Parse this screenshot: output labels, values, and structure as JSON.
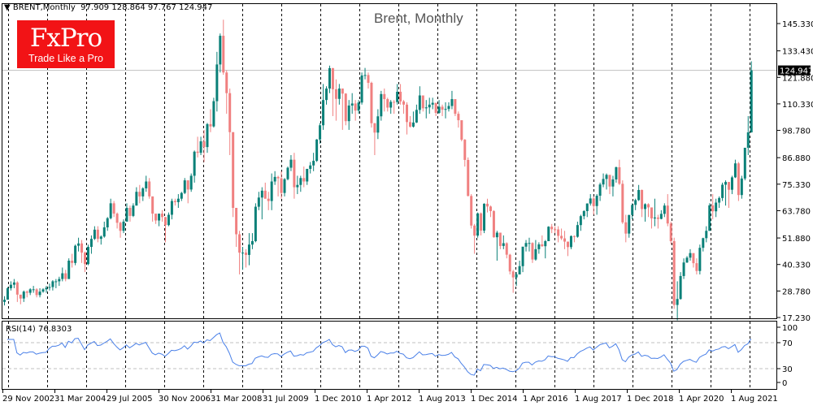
{
  "header": {
    "symbol": "BRENT,Monthly",
    "ohlc": "97.909 128.864 97.767 124.947"
  },
  "logo": {
    "brand": "FxPro",
    "tagline": "Trade Like a Pro"
  },
  "colors": {
    "bull": "#0a8078",
    "bear": "#f08080",
    "rsi": "#4a80e8",
    "grid": "#000000",
    "price_label_bg": "#000000"
  },
  "chart_data": {
    "type": "candlestick",
    "title": "Brent, Monthly",
    "timeframe": "monthly",
    "first_bar": "Nov 2002",
    "last_bar": "Mar 2022",
    "ylim": [
      17.23,
      145.33
    ],
    "y_ticks": [
      "145.330",
      "133.430",
      "121.880",
      "110.330",
      "98.780",
      "86.880",
      "75.330",
      "63.780",
      "51.880",
      "40.330",
      "28.780",
      "17.230"
    ],
    "x_ticks": [
      "29 Nov 2002",
      "31 Mar 2004",
      "29 Jul 2005",
      "30 Nov 2006",
      "31 Mar 2008",
      "31 Jul 2009",
      "1 Dec 2010",
      "1 Apr 2012",
      "1 Aug 2013",
      "1 Dec 2014",
      "1 Apr 2016",
      "1 Aug 2017",
      "1 Dec 2018",
      "1 Apr 2020",
      "1 Aug 2021"
    ],
    "current_price": "124.947",
    "first_open": 24.0,
    "close": [
      25.0,
      30.0,
      31.5,
      32.5,
      27.2,
      25.5,
      28.5,
      28.0,
      29.5,
      29.5,
      27.0,
      28.5,
      29.5,
      30.2,
      30.5,
      33.0,
      33.0,
      34.0,
      36.5,
      34.0,
      42.0,
      41.0,
      48.5,
      49.5,
      45.5,
      40.5,
      48.0,
      51.5,
      55.5,
      51.5,
      52.5,
      56.5,
      60.5,
      67.0,
      62.5,
      58.5,
      55.0,
      59.0,
      65.0,
      61.5,
      66.0,
      72.0,
      70.0,
      73.5,
      76.5,
      70.0,
      62.5,
      59.5,
      62.5,
      61.0,
      57.5,
      62.0,
      68.0,
      67.5,
      69.0,
      71.5,
      77.0,
      73.0,
      79.0,
      89.5,
      89.0,
      94.0,
      91.5,
      101.5,
      100.5,
      111.5,
      127.5,
      140.0,
      124.0,
      115.0,
      98.0,
      65.0,
      53.5,
      45.5,
      45.5,
      44.5,
      49.0,
      50.5,
      65.5,
      69.5,
      72.5,
      69.0,
      68.0,
      76.5,
      78.5,
      77.9,
      71.5,
      77.5,
      82.5,
      86.0,
      74.0,
      75.0,
      78.0,
      76.5,
      82.0,
      83.5,
      85.5,
      94.8,
      101.0,
      112.0,
      117.0,
      125.9,
      116.7,
      112.5,
      117.0,
      114.8,
      102.8,
      109.6,
      110.5,
      107.4,
      110.9,
      122.7,
      122.9,
      119.5,
      101.9,
      97.8,
      104.9,
      114.6,
      112.4,
      108.7,
      111.2,
      111.1,
      115.6,
      111.4,
      110.0,
      102.4,
      100.4,
      102.2,
      107.7,
      114.0,
      108.4,
      108.8,
      110.0,
      110.8,
      106.4,
      109.1,
      107.8,
      108.1,
      109.4,
      112.4,
      106.0,
      103.2,
      94.7,
      85.9,
      70.2,
      57.3,
      52.9,
      62.6,
      55.1,
      66.8,
      65.6,
      63.6,
      52.2,
      54.2,
      48.4,
      49.6,
      44.6,
      37.3,
      34.7,
      36.0,
      39.6,
      48.1,
      49.7,
      49.7,
      42.5,
      47.0,
      49.1,
      48.3,
      50.5,
      56.8,
      55.7,
      55.6,
      52.8,
      51.7,
      50.3,
      47.9,
      52.7,
      52.4,
      57.5,
      61.4,
      63.6,
      66.9,
      69.1,
      65.8,
      70.3,
      75.2,
      77.6,
      79.4,
      74.3,
      77.4,
      82.7,
      75.5,
      58.7,
      53.8,
      61.9,
      66.3,
      68.4,
      72.8,
      64.5,
      66.6,
      65.2,
      60.4,
      60.8,
      60.2,
      62.4,
      66.0,
      58.2,
      50.5,
      22.7,
      25.3,
      35.3,
      41.2,
      43.3,
      45.3,
      40.9,
      37.5,
      47.6,
      51.8,
      55.0,
      66.1,
      63.5,
      67.3,
      69.3,
      75.1,
      76.3,
      72.9,
      78.3,
      84.4,
      70.6,
      77.8,
      91.2,
      97.909,
      124.947
    ],
    "high": [
      26.5,
      30.5,
      33,
      34,
      33,
      27,
      29,
      29,
      30,
      31,
      30,
      30,
      30,
      31,
      32,
      33.5,
      34,
      35,
      39,
      38,
      43,
      45,
      49,
      52,
      51,
      46,
      49,
      53,
      57,
      57,
      53,
      59,
      61,
      69,
      68,
      63,
      59,
      60,
      67,
      66,
      67,
      74,
      75,
      74,
      79,
      78,
      70,
      62,
      62,
      64,
      61,
      63,
      69,
      69,
      71,
      72,
      78,
      77,
      80,
      90,
      96,
      96,
      99,
      102,
      108,
      113,
      133,
      141,
      147,
      125,
      117,
      98,
      65,
      55,
      48,
      47,
      54,
      54,
      67,
      72,
      74,
      76,
      72,
      80,
      81,
      79,
      81,
      78,
      83,
      88,
      89,
      79,
      79,
      83,
      82,
      85,
      89,
      95,
      102,
      119,
      118,
      127,
      126,
      121,
      119,
      117,
      115,
      112,
      115,
      112,
      112,
      124,
      126,
      124,
      120,
      102,
      108,
      116,
      117,
      113,
      112,
      112,
      119,
      119,
      112,
      111,
      105,
      107,
      110,
      118,
      113,
      112,
      113,
      113,
      110,
      112,
      110,
      111,
      111,
      116,
      112,
      107,
      103,
      95,
      87,
      71,
      58,
      63,
      63,
      67,
      69,
      66,
      64,
      55,
      54,
      53,
      50,
      45,
      38,
      37,
      42,
      48,
      51,
      52,
      50,
      51,
      50,
      53,
      51,
      57,
      58,
      57,
      57,
      56,
      55,
      50,
      53,
      53,
      59,
      62,
      64,
      67,
      71,
      70,
      71,
      76,
      80,
      80,
      79,
      79,
      83,
      86,
      77,
      62,
      62,
      67,
      69,
      75,
      73,
      67,
      67,
      65,
      69,
      62,
      64,
      67,
      71,
      59,
      52,
      33,
      37,
      43,
      44,
      47,
      45,
      43,
      49,
      52,
      57,
      67,
      71,
      69,
      70,
      76,
      77,
      73,
      79,
      86,
      85,
      79,
      91,
      105,
      128.864
    ],
    "low": [
      22.5,
      25,
      29,
      30,
      24,
      23,
      24,
      26,
      27,
      28,
      26,
      26,
      28,
      28,
      29,
      29,
      30,
      31,
      33,
      33,
      34,
      39,
      40,
      46,
      41,
      37,
      40,
      45,
      51,
      50,
      49,
      52,
      55,
      60,
      61,
      56,
      52,
      54,
      59,
      59,
      61,
      66,
      67,
      68,
      72,
      69,
      59,
      58,
      57,
      59,
      50,
      57,
      60,
      66,
      65,
      68,
      71,
      67,
      72,
      76,
      87,
      88,
      85,
      89,
      98,
      100,
      107,
      124,
      123,
      106,
      88,
      61,
      48,
      36,
      38,
      39,
      40,
      47,
      50,
      64,
      60,
      69,
      64,
      64,
      75,
      70,
      69,
      70,
      77,
      81,
      69,
      71,
      72,
      74,
      75,
      80,
      81,
      85,
      93,
      99,
      110,
      115,
      105,
      103,
      110,
      99,
      101,
      99,
      106,
      103,
      106,
      110,
      121,
      117,
      100,
      88,
      95,
      103,
      107,
      107,
      106,
      106,
      110,
      110,
      106,
      97,
      100,
      100,
      102,
      106,
      107,
      104,
      106,
      108,
      105,
      106,
      105,
      104,
      107,
      108,
      105,
      100,
      94,
      83,
      70,
      56,
      45,
      52,
      53,
      54,
      63,
      61,
      52,
      42,
      47,
      47,
      43,
      36,
      28,
      31,
      36,
      37,
      46,
      46,
      41,
      42,
      45,
      48,
      43,
      52,
      54,
      54,
      50,
      51,
      47,
      44,
      47,
      50,
      52,
      55,
      60,
      61,
      66,
      62,
      62,
      68,
      74,
      73,
      71,
      70,
      76,
      75,
      58,
      50,
      52,
      60,
      64,
      68,
      61,
      59,
      61,
      56,
      57,
      56,
      60,
      61,
      57,
      49,
      21,
      16,
      25,
      34,
      41,
      42,
      39,
      36,
      36,
      46,
      50,
      55,
      60,
      61,
      65,
      68,
      66,
      65,
      71,
      78,
      68,
      69,
      77,
      88,
      97.767
    ],
    "indicator": {
      "name": "RSI(14)",
      "label": "RSI(14) 76.8303",
      "period": 14,
      "ylim": [
        0,
        100
      ],
      "levels": [
        30,
        70
      ],
      "y_ticks": [
        "100",
        "70",
        "30",
        "0"
      ]
    }
  }
}
